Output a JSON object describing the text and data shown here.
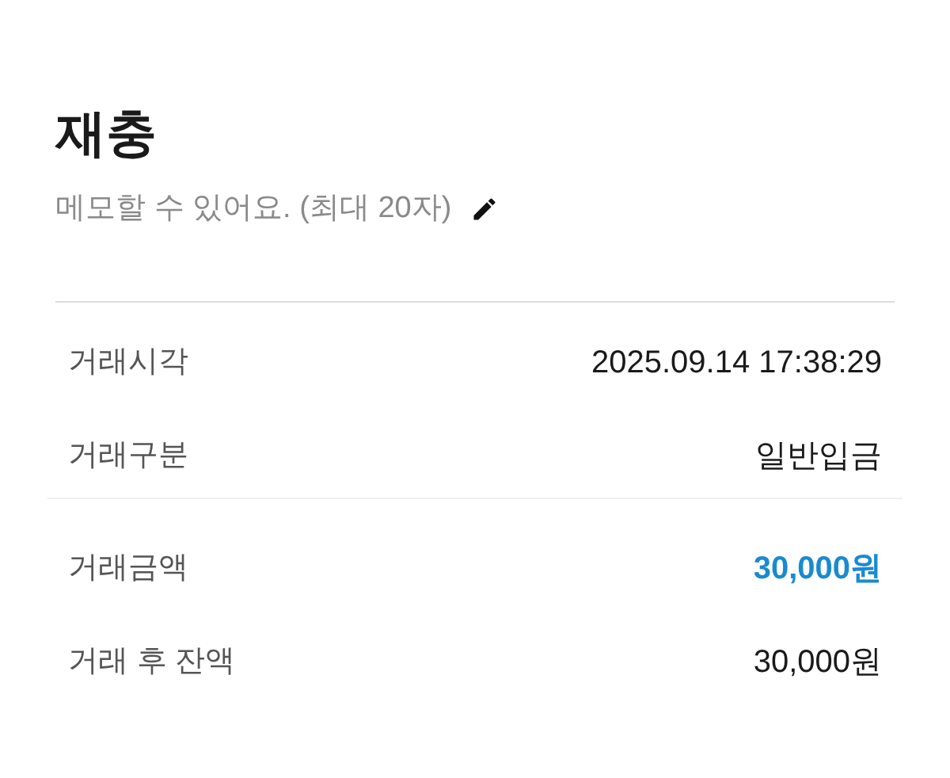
{
  "title": "재충",
  "memo": {
    "placeholder": "메모할 수 있어요. (최대 20자)"
  },
  "sections": [
    {
      "rows": [
        {
          "label": "거래시각",
          "value": "2025.09.14 17:38:29",
          "emphasis": false
        },
        {
          "label": "거래구분",
          "value": "일반입금",
          "emphasis": false
        }
      ]
    },
    {
      "rows": [
        {
          "label": "거래금액",
          "value": "30,000원",
          "emphasis": true
        },
        {
          "label": "거래 후 잔액",
          "value": "30,000원",
          "emphasis": false
        }
      ]
    }
  ]
}
